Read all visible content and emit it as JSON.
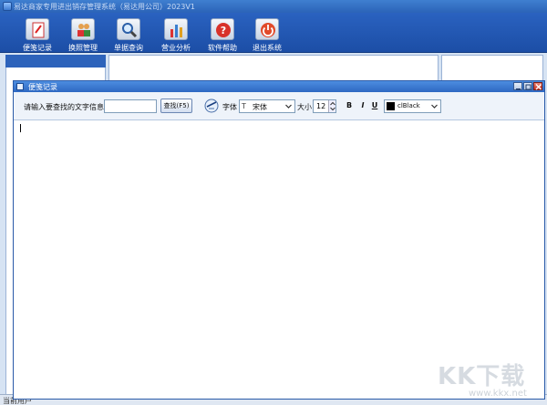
{
  "app": {
    "title": "易达商家专用进出销存管理系统（易达用公司）2023V1"
  },
  "toolbar": {
    "items": [
      {
        "label": "便笺记录",
        "icon": "notepad-icon"
      },
      {
        "label": "换照管理",
        "icon": "users-icon"
      },
      {
        "label": "单据查询",
        "icon": "magnifier-icon"
      },
      {
        "label": "营业分析",
        "icon": "bar-chart-icon"
      },
      {
        "label": "软件帮助",
        "icon": "help-icon"
      },
      {
        "label": "退出系统",
        "icon": "power-icon"
      }
    ]
  },
  "dialog": {
    "title": "便笺记录",
    "search_label": "请输入要查找的文字信息：",
    "search_value": "",
    "search_button": "查找(F5)",
    "font_label": "字体",
    "font_icon_glyph": "T",
    "font_value": "宋体",
    "size_label": "大小",
    "size_value": "12",
    "bold_label": "B",
    "italic_label": "I",
    "underline_label": "U",
    "color_value": "clBlack",
    "color_hex": "#000000"
  },
  "status": {
    "text": "当前用户"
  },
  "watermark": {
    "text": "KK下载",
    "url": "www.kkx.net"
  }
}
